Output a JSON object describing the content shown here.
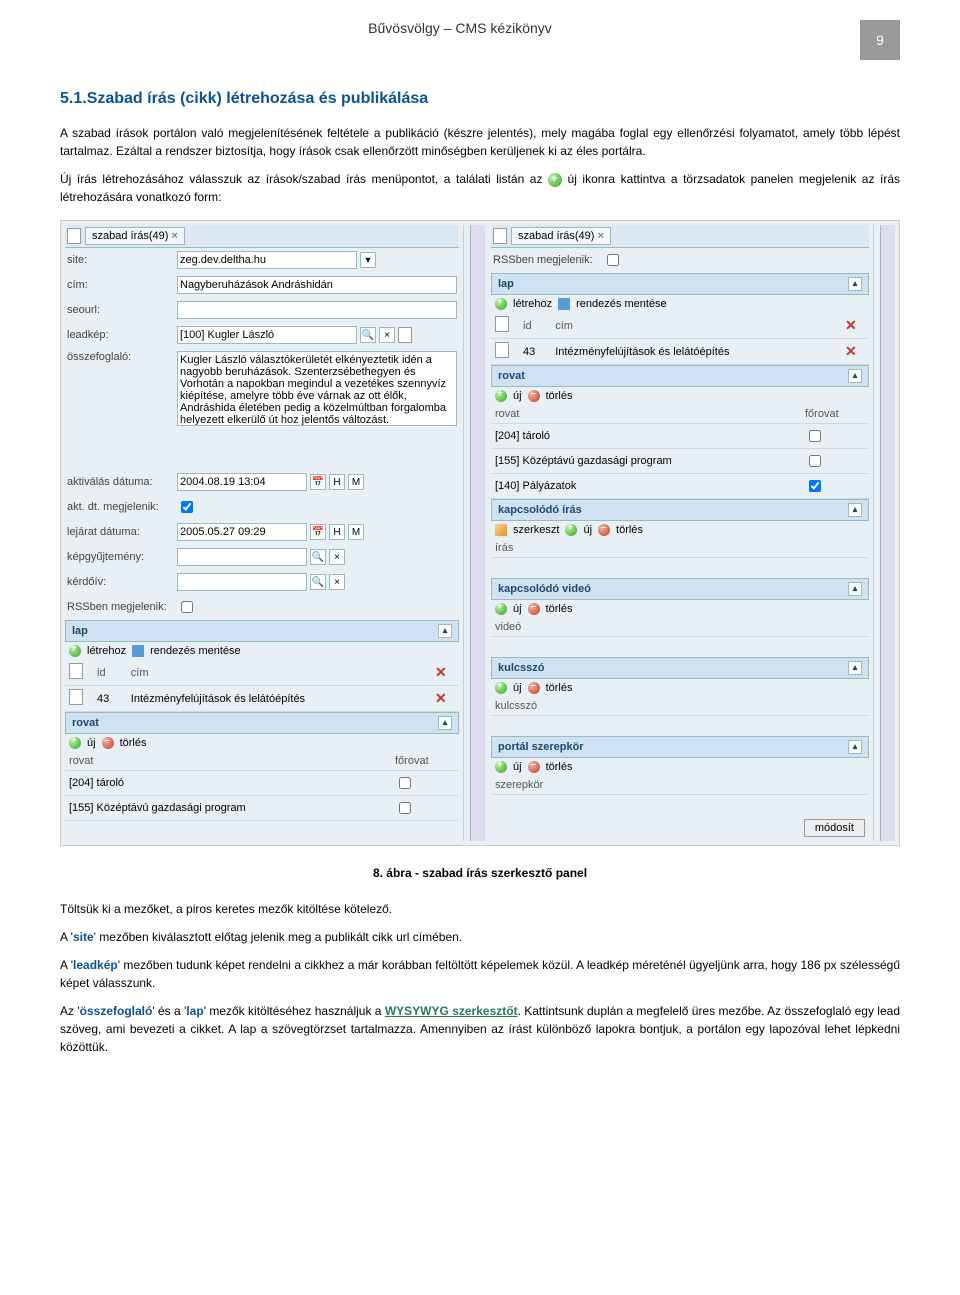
{
  "header": {
    "title": "Bűvösvölgy – CMS kézikönyv",
    "page_number": "9"
  },
  "h2": "5.1.Szabad írás (cikk) létrehozása és publikálása",
  "p1": "A szabad írások portálon való megjelenítésének feltétele a publikáció (készre jelentés), mely magába foglal egy ellenőrzési folyamatot, amely több lépést tartalmaz. Ezáltal a rendszer biztosítja, hogy írások csak ellenőrzött minőségben kerüljenek ki az éles portálra.",
  "p2": "Új írás létrehozásához válasszuk az írások/szabad írás menüpontot, a találati listán az",
  "p2b": "új ikonra kattintva a törzsadatok panelen megjelenik az írás létrehozására vonatkozó form:",
  "left": {
    "tab": "szabad írás(49)",
    "fields": {
      "site": {
        "label": "site:",
        "value": "zeg.dev.deltha.hu"
      },
      "cim": {
        "label": "cím:",
        "value": "Nagyberuházások Andráshidán"
      },
      "seourl": {
        "label": "seourl:",
        "value": ""
      },
      "leadkep": {
        "label": "leadkép:",
        "value": "[100] Kugler László"
      },
      "ossz": {
        "label": "összefoglaló:",
        "value": "Kugler László választókerületét elkényeztetik idén a nagyobb beruházások. Szenterzsébethegyen és Vorhotán a napokban megindul a vezetékes szennyvíz kiépítése, amelyre több éve várnak az ott élők, Andráshida életében pedig a közelmúltban forgalomba helyezett elkerülő út hoz jelentős változást."
      },
      "aktival": {
        "label": "aktiválás dátuma:",
        "value": "2004.08.19 13:04"
      },
      "aktmeg": {
        "label": "akt. dt. megjelenik:"
      },
      "lejarat": {
        "label": "lejárat dátuma:",
        "value": "2005.05.27 09:29"
      },
      "kepgyujt": {
        "label": "képgyűjtemény:"
      },
      "kerdoiv": {
        "label": "kérdőív:"
      },
      "rss": {
        "label": "RSSben megjelenik:"
      }
    },
    "lap": {
      "title": "lap",
      "create": "létrehoz",
      "saveorder": "rendezés mentése",
      "cols": {
        "id": "id",
        "cim": "cím"
      },
      "rows": [
        {
          "id": "43",
          "cim": "Intézményfelújítások és lelátóépítés"
        }
      ]
    },
    "rovat": {
      "title": "rovat",
      "add": "új",
      "del": "törlés",
      "cols": {
        "rovat": "rovat",
        "forovat": "főrovat"
      },
      "rows": [
        {
          "name": "[204] tároló",
          "chk": false
        },
        {
          "name": "[155] Középtávú gazdasági program",
          "chk": false
        }
      ]
    }
  },
  "right": {
    "tab": "szabad írás(49)",
    "rss": {
      "label": "RSSben megjelenik:"
    },
    "lap": {
      "title": "lap",
      "create": "létrehoz",
      "saveorder": "rendezés mentése",
      "cols": {
        "id": "id",
        "cim": "cím"
      },
      "rows": [
        {
          "id": "43",
          "cim": "Intézményfelújítások és lelátóépítés"
        }
      ]
    },
    "rovat": {
      "title": "rovat",
      "add": "új",
      "del": "törlés",
      "cols": {
        "rovat": "rovat",
        "forovat": "főrovat"
      },
      "rows": [
        {
          "name": "[204] tároló",
          "chk": false
        },
        {
          "name": "[155] Középtávú gazdasági program",
          "chk": false
        },
        {
          "name": "[140] Pályázatok",
          "chk": true
        }
      ]
    },
    "kapcs_iras": {
      "title": "kapcsolódó írás",
      "edit": "szerkeszt",
      "add": "új",
      "del": "törlés",
      "col": "írás"
    },
    "kapcs_video": {
      "title": "kapcsolódó videó",
      "add": "új",
      "del": "törlés",
      "col": "videó"
    },
    "kulcsszo": {
      "title": "kulcsszó",
      "add": "új",
      "del": "törlés",
      "col": "kulcsszó"
    },
    "szerepkor": {
      "title": "portál szerepkör",
      "add": "új",
      "del": "törlés",
      "col": "szerepkör"
    },
    "modosit": "módosít"
  },
  "caption": "8. ábra  - szabad írás szerkesztő panel",
  "p3": "Töltsük ki a mezőket, a piros keretes mezők kitöltése kötelező.",
  "p4a": "A '",
  "p4kw": "site",
  "p4b": "' mezőben kiválasztott előtag jelenik meg a publikált cikk url címében.",
  "p5a": "A '",
  "p5kw": "leadkép",
  "p5b": "' mezőben tudunk képet rendelni a cikkhez a már korábban feltöltött képelemek közül. A leadkép méreténél ügyeljünk arra, hogy 186 px szélességű képet válasszunk.",
  "p6a": "Az '",
  "p6kw1": "összefoglaló",
  "p6mid": "' és a '",
  "p6kw2": "lap",
  "p6b": "' mezők kitöltéséhez használjuk a ",
  "p6wys": "WYSYWYG szerkesztőt",
  "p6c": ". Kattintsunk duplán a megfelelő üres mezőbe. Az összefoglaló egy lead szöveg, ami bevezeti a cikket. A lap a szövegtörzset tartalmazza. Amennyiben az írást különböző lapokra bontjuk, a portálon egy lapozóval lehet lépkedni közöttük."
}
